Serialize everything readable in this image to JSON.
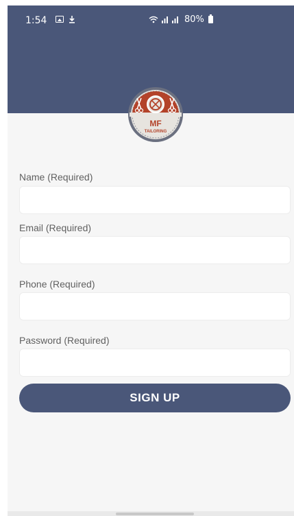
{
  "status_bar": {
    "time": "1:54",
    "battery": "80%",
    "icons": [
      "gallery-icon",
      "download-icon",
      "wifi-icon",
      "signal-icon",
      "battery-icon"
    ]
  },
  "logo": {
    "text_main": "MF",
    "text_sub": "TAILORING",
    "colors": {
      "badge": "#b3432a",
      "ring": "#5a5f70"
    }
  },
  "form": {
    "name": {
      "label": "Name (Required)",
      "value": "",
      "placeholder": ""
    },
    "email": {
      "label": "Email (Required)",
      "value": "",
      "placeholder": ""
    },
    "phone": {
      "label": "Phone (Required)",
      "value": "",
      "placeholder": ""
    },
    "password": {
      "label": "Password (Required)",
      "value": "",
      "placeholder": ""
    },
    "submit_label": "SIGN UP"
  },
  "colors": {
    "primary": "#4a5779",
    "background": "#f6f6f6"
  }
}
